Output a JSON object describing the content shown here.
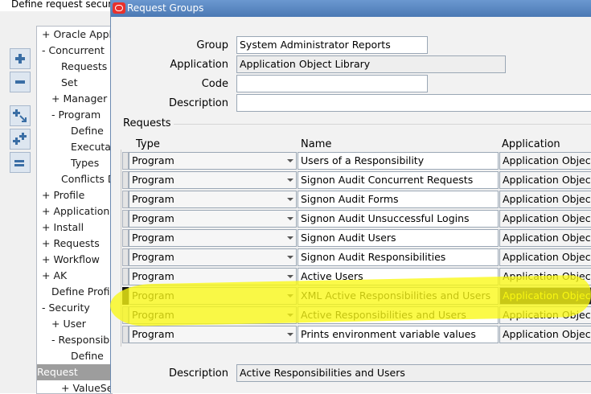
{
  "background_window": {
    "title": "Define request secur",
    "nav_buttons": [
      "expand-icon",
      "collapse-icon",
      "expand-branch-icon",
      "expand-all-icon",
      "collapse-all-icon"
    ],
    "tree": [
      {
        "label": "+ Oracle Appli",
        "indent": 0
      },
      {
        "label": "- Concurrent",
        "indent": 0
      },
      {
        "label": "Requests",
        "indent": 2
      },
      {
        "label": "Set",
        "indent": 2
      },
      {
        "label": "+ Manager",
        "indent": 1
      },
      {
        "label": "- Program",
        "indent": 1
      },
      {
        "label": "Define",
        "indent": 3
      },
      {
        "label": "Executa",
        "indent": 3
      },
      {
        "label": "Types",
        "indent": 3
      },
      {
        "label": "Conflicts D",
        "indent": 2
      },
      {
        "label": "+ Profile",
        "indent": 0
      },
      {
        "label": "+ Application",
        "indent": 0
      },
      {
        "label": "+ Install",
        "indent": 0
      },
      {
        "label": "+ Requests",
        "indent": 0
      },
      {
        "label": "+ Workflow",
        "indent": 0
      },
      {
        "label": "+ AK",
        "indent": 0
      },
      {
        "label": "Define Profile",
        "indent": 1
      },
      {
        "label": "- Security",
        "indent": 0
      },
      {
        "label": "+ User",
        "indent": 1
      },
      {
        "label": "- Responsibi",
        "indent": 1
      },
      {
        "label": "Define",
        "indent": 3
      },
      {
        "label": "Request",
        "indent": 3,
        "selected": true
      },
      {
        "label": "+ ValueSe",
        "indent": 2
      }
    ]
  },
  "dialog": {
    "title": "Request Groups",
    "form": {
      "group_label": "Group",
      "group_value": "System Administrator Reports",
      "application_label": "Application",
      "application_value": "Application Object Library",
      "code_label": "Code",
      "code_value": "",
      "description_label": "Description",
      "description_value": ""
    },
    "requests": {
      "legend": "Requests",
      "headers": {
        "type": "Type",
        "name": "Name",
        "application": "Application"
      },
      "rows": [
        {
          "type": "Program",
          "name": "Users of a Responsibility",
          "application": "Application Object L"
        },
        {
          "type": "Program",
          "name": "Signon Audit Concurrent Requests",
          "application": "Application Object L"
        },
        {
          "type": "Program",
          "name": "Signon Audit Forms",
          "application": "Application Object L"
        },
        {
          "type": "Program",
          "name": "Signon Audit Unsuccessful Logins",
          "application": "Application Object L"
        },
        {
          "type": "Program",
          "name": "Signon Audit Users",
          "application": "Application Object L"
        },
        {
          "type": "Program",
          "name": "Signon Audit Responsibilities",
          "application": "Application Object L"
        },
        {
          "type": "Program",
          "name": "Active Users",
          "application": "Application Object L"
        },
        {
          "type": "Program",
          "name": "XML Active Responsibilities and Users",
          "application": "Application Object L",
          "current": true
        },
        {
          "type": "Program",
          "name": "Active Responsibilities and Users",
          "application": "Application Object L"
        },
        {
          "type": "Program",
          "name": "Prints environment variable values",
          "application": "Application Object L"
        }
      ]
    },
    "footer": {
      "description_label": "Description",
      "description_value": "Active Responsibilities and Users"
    }
  },
  "colors": {
    "titlebar": "#5a88c2",
    "highlight": "#f7f514",
    "selected_tree_item": "#9d9d9d"
  }
}
